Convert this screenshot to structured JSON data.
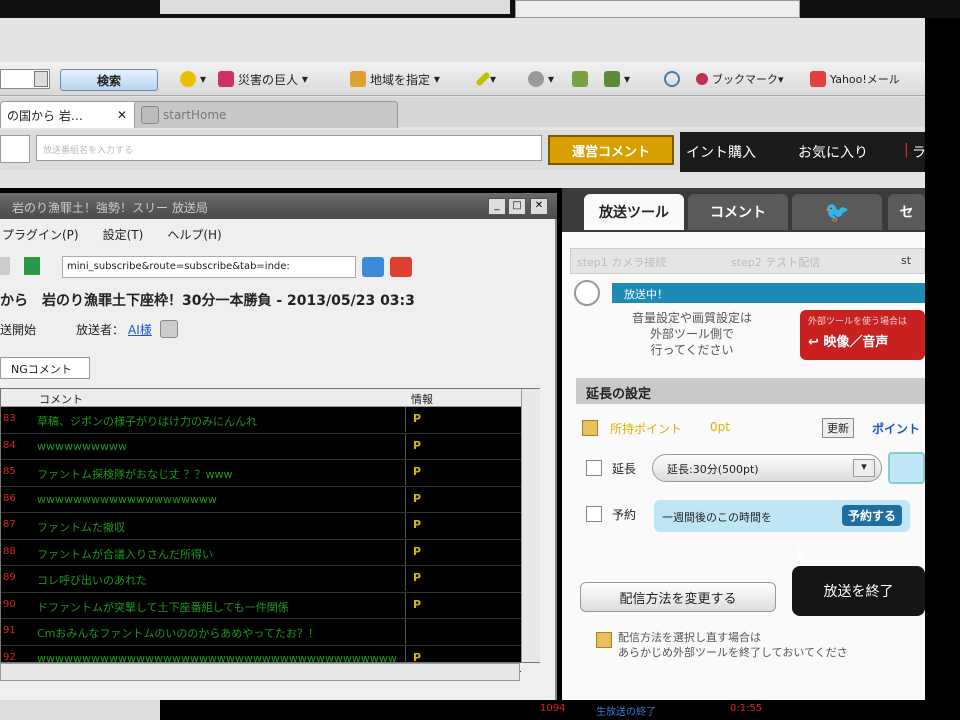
{
  "browser": {
    "topbar_field": "",
    "toolbar": {
      "search_button": "検索",
      "item_disaster": "災害の巨人",
      "item_region": "地域を指定",
      "bookmark": "ブックマーク",
      "yahoo_mail": "Yahoo!メール"
    },
    "tabs": [
      {
        "label": "の国から 岩…"
      },
      {
        "label": "startHome"
      }
    ],
    "address_placeholder": "放送番組名を入力する",
    "comment_button": "運営コメント",
    "nav": {
      "buy_points": "イント購入",
      "favorites": "お気に入り",
      "more": "ラ"
    }
  },
  "viewer": {
    "title": "岩のり漁罪土！強勢！スリー 放送局",
    "menu": [
      "プラグイン(P)",
      "設定(T)",
      "ヘルプ(H)"
    ],
    "url": "mini_subscribe&route=subscribe&tab=inde:",
    "heading": "から　岩のり漁罪土下座枠！30分一本勝負 - 2013/05/23 03:3",
    "sub_start": "送開始",
    "sub_broadcaster_label": "放送者：",
    "sub_broadcaster_name": "AI様",
    "ng_tab": "NGコメント",
    "columns": {
      "comment": "コメント",
      "info": "情報"
    },
    "rows": [
      {
        "num": "83",
        "text": "草稿、ジボンの様子がりはけ力のみにんんれ",
        "info": "P"
      },
      {
        "num": "84",
        "text": "wwwwwwwwww",
        "info": "P"
      },
      {
        "num": "85",
        "text": "ファントム探検隊がおなじ丈 ？？www",
        "info": "P"
      },
      {
        "num": "86",
        "text": "wwwwwwwwwwwwwwwwwwww",
        "info": "P"
      },
      {
        "num": "87",
        "text": "ファントムた撤収",
        "info": "P"
      },
      {
        "num": "88",
        "text": "ファントムが合議入りさんだ所得い",
        "info": "P"
      },
      {
        "num": "89",
        "text": "コレ呼び出いのあれた",
        "info": "P"
      },
      {
        "num": "90",
        "text": "ドファントムが突撃して土下座番組しても一件関係",
        "info": "P"
      },
      {
        "num": "91",
        "text": "Cmおみんなファントムのいののからあめやってたお？！",
        "info": ""
      },
      {
        "num": "92",
        "text": "wwwwwwwwwwwwwwwwwwwwwwwwwwwwwwwwwwwwwwwwwwwww",
        "info": "P"
      }
    ]
  },
  "tool": {
    "tabs": {
      "broadcast": "放送ツール",
      "comment": "コメント",
      "settings": "セ"
    },
    "steps": [
      "step1 カメラ接続",
      "step2 テスト配信",
      "st"
    ],
    "onair": "放送中！",
    "notice": "音量設定や画質設定は\n外部ツール側で\n行ってください",
    "red_button_top": "外部ツールを使う場合は",
    "red_button": "映像／音声",
    "extension_title": "延長の設定",
    "points_label": "所持ポイント",
    "points_value": "0pt",
    "update": "更新",
    "point_link": "ポイント",
    "extend_label": "延長",
    "extend_select": "延長:30分(500pt)",
    "reserve_label": "予約",
    "reserve_text": "一週間後のこの時間を",
    "reserve_button": "予約する",
    "method_button": "配信方法を変更する",
    "end_button": "放送を終了",
    "foot": "配信方法を選択し直す場合は\nあらかじめ外部ツールを終了しておいてくださ"
  },
  "bottom": {
    "a": "1094",
    "b": "生放送の終了",
    "c": "0:1:55"
  }
}
